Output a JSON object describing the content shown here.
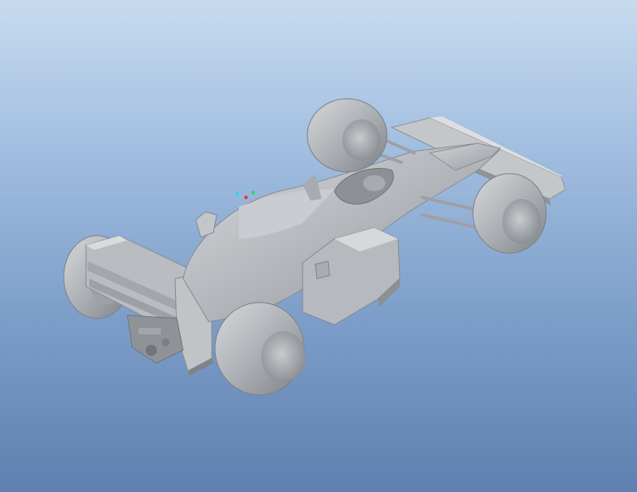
{
  "viewport": {
    "background_top": "#c7dbee",
    "background_bottom": "#5f80b0",
    "model_color": "#b4b7bb"
  },
  "model": {
    "icon": "f1-race-car-model"
  },
  "orientation_triad": {
    "icon": "xyz-axis-triad-icon",
    "x_color": "#ff2a2a",
    "y_color": "#22dd55",
    "z_color": "#22ddee"
  }
}
